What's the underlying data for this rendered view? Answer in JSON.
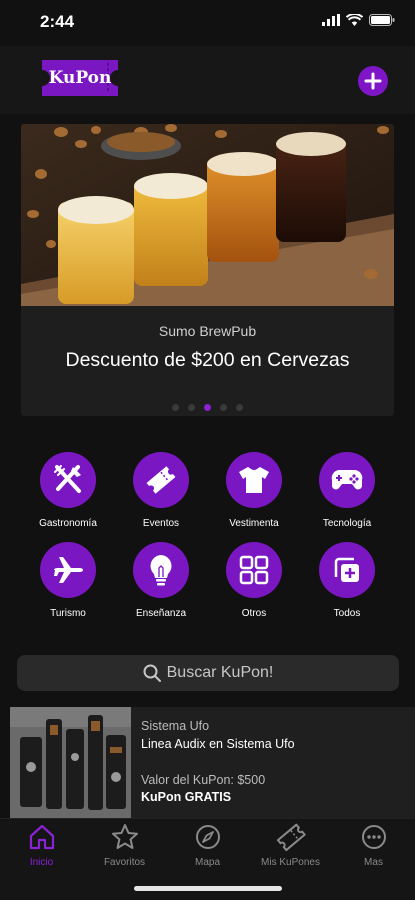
{
  "status": {
    "time": "2:44"
  },
  "header": {
    "logo_text": "KuPon"
  },
  "banner": {
    "subtitle": "Sumo BrewPub",
    "title": "Descuento de $200 en Cervezas",
    "active_dot": 3,
    "dot_count": 5
  },
  "categories": [
    {
      "label": "Gastronomía",
      "icon": "utensils-icon"
    },
    {
      "label": "Eventos",
      "icon": "ticket-icon"
    },
    {
      "label": "Vestimenta",
      "icon": "tshirt-icon"
    },
    {
      "label": "Tecnología",
      "icon": "gamepad-icon"
    },
    {
      "label": "Turismo",
      "icon": "airplane-icon"
    },
    {
      "label": "Enseñanza",
      "icon": "lightbulb-icon"
    },
    {
      "label": "Otros",
      "icon": "grid-icon"
    },
    {
      "label": "Todos",
      "icon": "stack-add-icon"
    }
  ],
  "search": {
    "placeholder": "Buscar KuPon!"
  },
  "deal": {
    "store": "Sistema Ufo",
    "title": "Linea Audix en Sistema Ufo",
    "value_label": "Valor del KuPon: $500",
    "price": "KuPon GRATIS"
  },
  "tabs": [
    {
      "label": "Inicio",
      "icon": "home-icon",
      "active": true
    },
    {
      "label": "Favoritos",
      "icon": "star-icon",
      "active": false
    },
    {
      "label": "Mapa",
      "icon": "compass-icon",
      "active": false
    },
    {
      "label": "Mis KuPones",
      "icon": "ticket-icon",
      "active": false
    },
    {
      "label": "Mas",
      "icon": "more-icon",
      "active": false
    }
  ],
  "colors": {
    "accent": "#7a17c2",
    "background": "#111111"
  }
}
